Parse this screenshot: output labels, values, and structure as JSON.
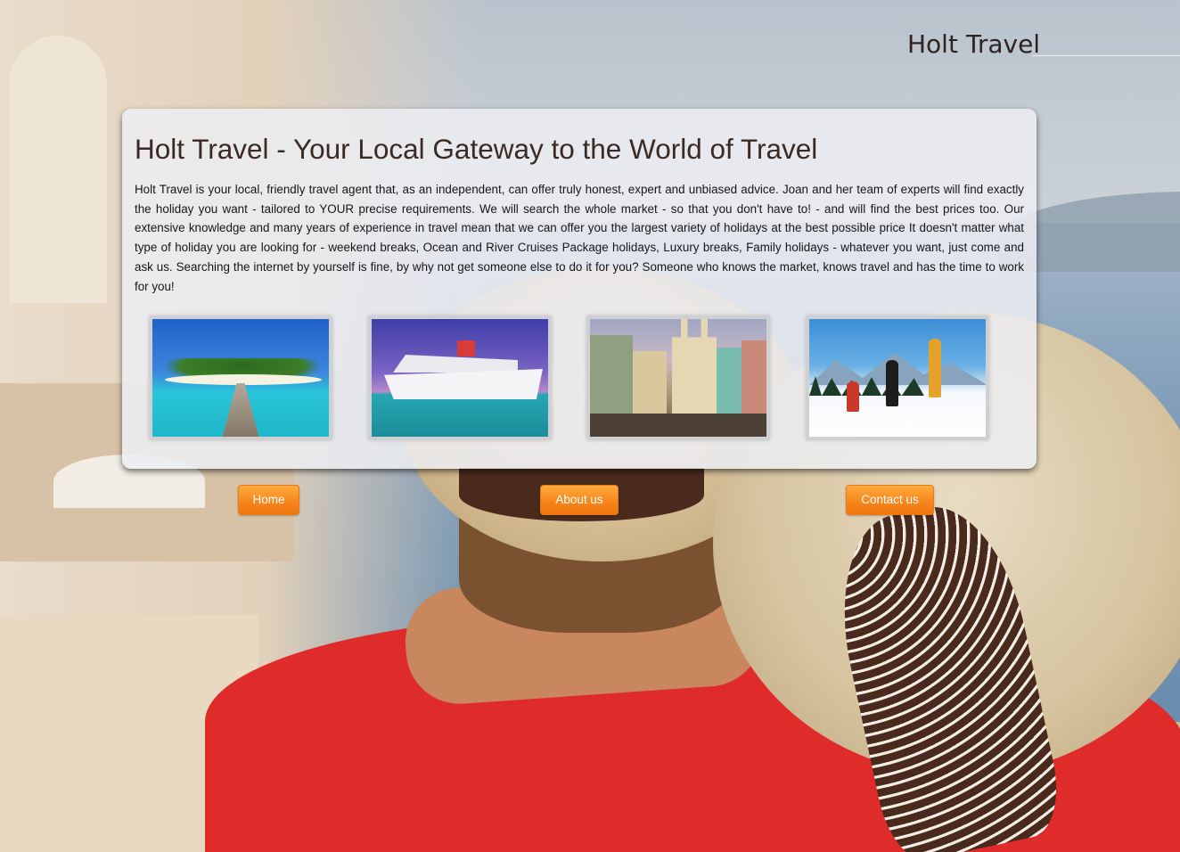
{
  "header": {
    "site_title": "Holt Travel"
  },
  "main": {
    "heading": "Holt Travel - Your Local Gateway to the World of Travel",
    "intro": "Holt Travel is your local, friendly travel agent that, as an independent, can offer truly honest, expert and unbiased advice. Joan and her team of experts will find exactly the holiday you want - tailored to YOUR precise requirements. We will search the whole market - so that you don't have to! - and will find the best prices too. Our extensive knowledge and many years of experience in travel mean that we can offer you the largest variety of holidays at the best possible price It doesn't matter what type of holiday you are looking for - weekend breaks, Ocean and River Cruises Package holidays, Luxury breaks, Family holidays - whatever you want, just come and ask us. Searching the internet by yourself is fine, by why not get someone else to do it for you? Someone who knows the market, knows travel and has the time to work for you!",
    "thumbnails": [
      {
        "subject": "tropical-island-pier"
      },
      {
        "subject": "cruise-ship"
      },
      {
        "subject": "colonial-town-street"
      },
      {
        "subject": "snowshoe-hikers"
      }
    ]
  },
  "nav": {
    "home": "Home",
    "about": "About us",
    "contact": "Contact us"
  },
  "colors": {
    "button_orange": "#f6841a",
    "heading_brown": "#3a2a23",
    "panel_bg": "#eceef2"
  }
}
